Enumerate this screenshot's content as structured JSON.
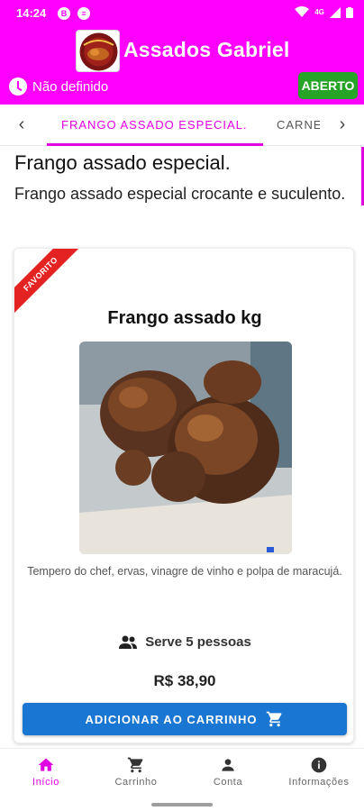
{
  "status_bar": {
    "time": "14:24",
    "network": "4G"
  },
  "header": {
    "title": "Assados Gabriel",
    "opening_hours": "Não definido",
    "open_status": "ABERTO"
  },
  "tabs": {
    "items": [
      {
        "label": "FRANGO ASSADO ESPECIAL.",
        "active": true
      },
      {
        "label": "CARNE",
        "active": false
      }
    ]
  },
  "category": {
    "title": "Frango assado especial.",
    "description": "Frango assado especial crocante e suculento."
  },
  "product": {
    "badge": "FAVORITO",
    "name": "Frango assado kg",
    "description": "Tempero do chef, ervas, vinagre de vinho e polpa de maracujá.",
    "serves": "Serve 5 pessoas",
    "price": "R$ 38,90",
    "add_button": "ADICIONAR AO CARRINHO"
  },
  "bottom_nav": [
    {
      "label": "Início",
      "icon": "home-icon",
      "active": true
    },
    {
      "label": "Carrinho",
      "icon": "cart-icon",
      "active": false
    },
    {
      "label": "Conta",
      "icon": "person-icon",
      "active": false
    },
    {
      "label": "Informações",
      "icon": "info-icon",
      "active": false
    }
  ],
  "colors": {
    "brand": "#ff00ff",
    "accent": "#e000e0",
    "open_badge": "#27a327",
    "button": "#1976d2",
    "ribbon": "#e52222"
  }
}
